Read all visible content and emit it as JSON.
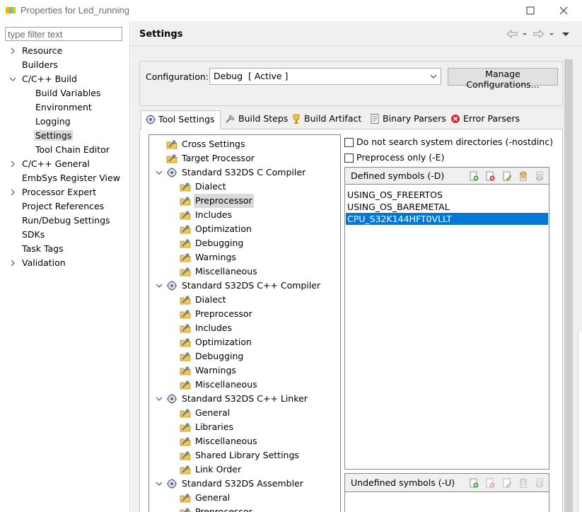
{
  "window": {
    "title": "Properties for Led_running"
  },
  "left_nav": {
    "filter_placeholder": "type filter text",
    "items": [
      {
        "label": "Resource",
        "expandable": true,
        "expanded": false,
        "indent": 0
      },
      {
        "label": "Builders",
        "expandable": false,
        "indent": 0
      },
      {
        "label": "C/C++ Build",
        "expandable": true,
        "expanded": true,
        "indent": 0
      },
      {
        "label": "Build Variables",
        "indent": 1
      },
      {
        "label": "Environment",
        "indent": 1
      },
      {
        "label": "Logging",
        "indent": 1
      },
      {
        "label": "Settings",
        "indent": 1,
        "selected": true
      },
      {
        "label": "Tool Chain Editor",
        "indent": 1
      },
      {
        "label": "C/C++ General",
        "expandable": true,
        "expanded": false,
        "indent": 0
      },
      {
        "label": "EmbSys Register View",
        "indent": 0
      },
      {
        "label": "Processor Expert",
        "expandable": true,
        "expanded": false,
        "indent": 0
      },
      {
        "label": "Project References",
        "indent": 0
      },
      {
        "label": "Run/Debug Settings",
        "indent": 0
      },
      {
        "label": "SDKs",
        "indent": 0
      },
      {
        "label": "Task Tags",
        "indent": 0
      },
      {
        "label": "Validation",
        "expandable": true,
        "expanded": false,
        "indent": 0
      }
    ]
  },
  "page": {
    "title": "Settings",
    "configuration_label": "Configuration:",
    "configuration_value": "Debug  [ Active ]",
    "manage_button": "Manage Configurations..."
  },
  "tabs": [
    {
      "label": "Tool Settings",
      "icon": "tool-settings-icon",
      "active": true
    },
    {
      "label": "Build Steps",
      "icon": "build-steps-icon",
      "active": false
    },
    {
      "label": "Build Artifact",
      "icon": "build-artifact-icon",
      "active": false
    },
    {
      "label": "Binary Parsers",
      "icon": "binary-parsers-icon",
      "active": false
    },
    {
      "label": "Error Parsers",
      "icon": "error-parsers-icon",
      "active": false
    }
  ],
  "tool_tree": [
    {
      "label": "Cross Settings",
      "level": 0
    },
    {
      "label": "Target Processor",
      "level": 0
    },
    {
      "label": "Standard S32DS C Compiler",
      "level": 0,
      "group": true
    },
    {
      "label": "Dialect",
      "level": 1
    },
    {
      "label": "Preprocessor",
      "level": 1,
      "selected": true
    },
    {
      "label": "Includes",
      "level": 1
    },
    {
      "label": "Optimization",
      "level": 1
    },
    {
      "label": "Debugging",
      "level": 1
    },
    {
      "label": "Warnings",
      "level": 1
    },
    {
      "label": "Miscellaneous",
      "level": 1
    },
    {
      "label": "Standard S32DS C++ Compiler",
      "level": 0,
      "group": true
    },
    {
      "label": "Dialect",
      "level": 1
    },
    {
      "label": "Preprocessor",
      "level": 1
    },
    {
      "label": "Includes",
      "level": 1
    },
    {
      "label": "Optimization",
      "level": 1
    },
    {
      "label": "Debugging",
      "level": 1
    },
    {
      "label": "Warnings",
      "level": 1
    },
    {
      "label": "Miscellaneous",
      "level": 1
    },
    {
      "label": "Standard S32DS C++ Linker",
      "level": 0,
      "group": true
    },
    {
      "label": "General",
      "level": 1
    },
    {
      "label": "Libraries",
      "level": 1
    },
    {
      "label": "Miscellaneous",
      "level": 1
    },
    {
      "label": "Shared Library Settings",
      "level": 1
    },
    {
      "label": "Link Order",
      "level": 1
    },
    {
      "label": "Standard S32DS Assembler",
      "level": 0,
      "group": true
    },
    {
      "label": "General",
      "level": 1
    },
    {
      "label": "Preprocessor",
      "level": 1
    }
  ],
  "options": {
    "nostdinc_label": "Do not search system directories (-nostdinc)",
    "nostdinc_checked": false,
    "preprocess_only_label": "Preprocess only (-E)",
    "preprocess_only_checked": false
  },
  "defined_symbols": {
    "title": "Defined symbols (-D)",
    "items": [
      "USING_OS_FREERTOS",
      "USING_OS_BAREMETAL",
      "CPU_S32K144HFT0VLLT"
    ],
    "selected_index": 2
  },
  "undefined_symbols": {
    "title": "Undefined symbols (-U)",
    "items": []
  },
  "colors": {
    "selection_blue": "#0078d7",
    "tree_selection_gray": "#d9d9d9",
    "panel_background": "#f0f0f0"
  }
}
